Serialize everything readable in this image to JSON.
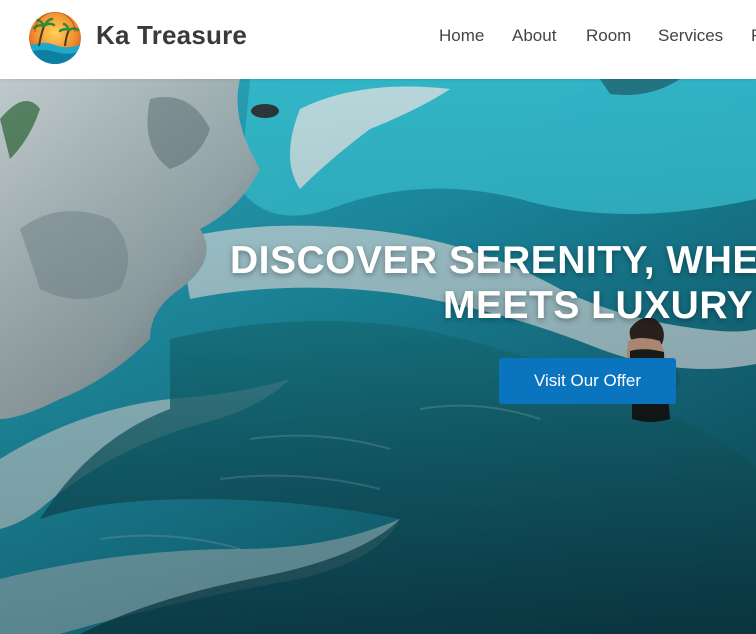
{
  "header": {
    "brand_name": "Ka Treasure",
    "nav": [
      {
        "label": "Home"
      },
      {
        "label": "About"
      },
      {
        "label": "Room"
      },
      {
        "label": "Services"
      },
      {
        "label": "F"
      }
    ]
  },
  "hero": {
    "headline_line1": "DISCOVER SERENITY, WHER",
    "headline_line2": "MEETS LUXURY",
    "cta_label": "Visit Our Offer"
  },
  "colors": {
    "accent": "#0a74bf",
    "header_bg": "#ffffff",
    "brand_text": "#3a3a3a"
  }
}
